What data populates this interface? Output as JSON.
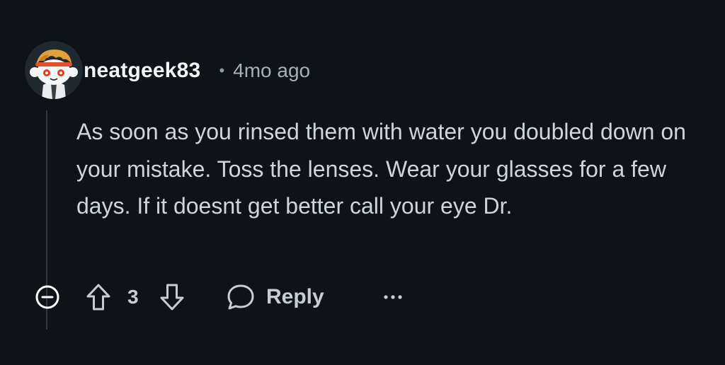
{
  "comment": {
    "username": "neatgeek83",
    "separator": "•",
    "time": "4mo ago",
    "body": "As soon as you rinsed them with water you doubled down on your mistake. Toss the lenses. Wear your glasses for a few days. If it doesnt get better call your eye Dr."
  },
  "actions": {
    "score": "3",
    "reply_label": "Reply",
    "more_label": "···"
  },
  "icons": {
    "collapse": "minus-circle-icon",
    "upvote": "arrow-up-icon",
    "downvote": "arrow-down-icon",
    "reply": "speech-bubble-icon",
    "more": "ellipsis-icon"
  },
  "colors": {
    "background": "#0d1418",
    "username": "#f2f4f5",
    "body_text": "#cdd6db",
    "muted": "#a3b1b8",
    "action": "#c5ced3"
  }
}
